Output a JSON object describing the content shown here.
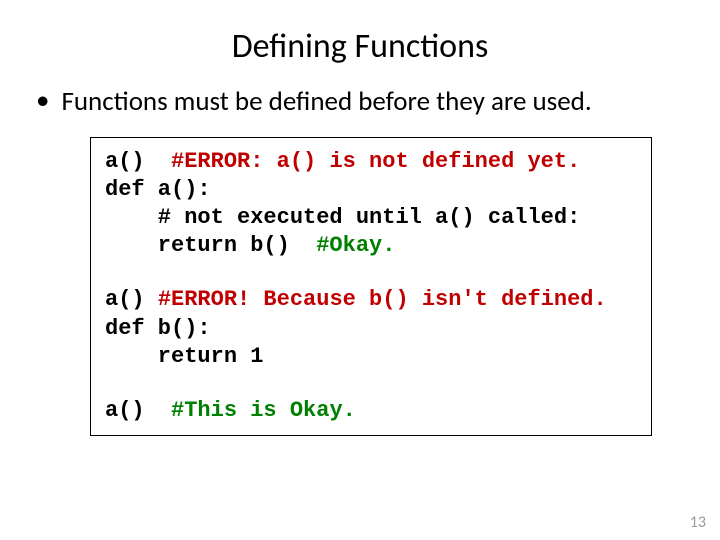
{
  "title": "Defining Functions",
  "bullet": "Functions must be defined before they are used.",
  "code": {
    "l1a": "a()  ",
    "l1b": "#ERROR: a() is not defined yet.",
    "l2": "def a():",
    "l3": "    # not executed until a() called:",
    "l4a": "    return b()  ",
    "l4b": "#Okay.",
    "l5a": "a() ",
    "l5b": "#ERROR! Because b() isn't defined.",
    "l6": "def b():",
    "l7": "    return 1",
    "l8a": "a()  ",
    "l8b": "#This is Okay."
  },
  "page_number": "13"
}
